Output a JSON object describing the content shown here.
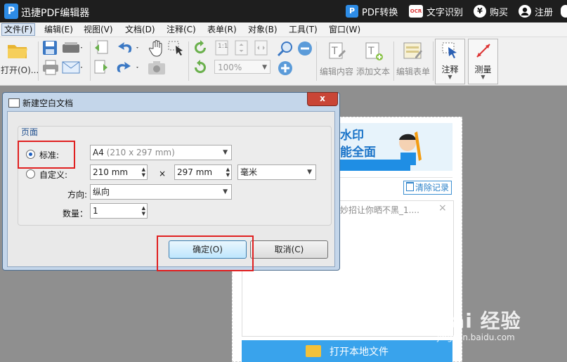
{
  "app": {
    "logo": "P",
    "title": "迅捷PDF编辑器",
    "pdf_convert": "PDF转换",
    "ocr_icon": "OCR",
    "ocr": "文字识别",
    "buy_icon": "¥",
    "buy": "购买",
    "register": "注册"
  },
  "menu": [
    "文件(F)",
    "编辑(E)",
    "视图(V)",
    "文档(D)",
    "注释(C)",
    "表单(R)",
    "对象(B)",
    "工具(T)",
    "窗口(W)"
  ],
  "toolbar": {
    "open": "打开(O)...",
    "zoom": "100%",
    "edit_content": "编辑内容",
    "add_text": "添加文本",
    "edit_form": "编辑表单",
    "annotate": "注释",
    "measure": "测量",
    "page_num": "1:1"
  },
  "panel": {
    "banner_line1": "水印",
    "banner_line2": "能全面",
    "clear_history": "清除记录",
    "recent_file": "妙招让你晒不黑_1....",
    "close_glyph": "×",
    "open_local": "打开本地文件"
  },
  "dialog": {
    "title": "新建空白文档",
    "close": "x",
    "group": "页面",
    "standard_label": "标准:",
    "standard_value": "A4",
    "standard_dims": "(210 x 297 mm)",
    "custom_label": "自定义:",
    "width": "210 mm",
    "times": "×",
    "height": "297 mm",
    "unit": "毫米",
    "orientation_label": "方向:",
    "orientation": "纵向",
    "count_label": "数量：",
    "count": "1",
    "ok": "确定(O)",
    "cancel": "取消(C)"
  },
  "watermark": {
    "main": "Bai 经验",
    "url": "jingyan.baidu.com"
  },
  "colors": {
    "accent": "#39a3ec",
    "highlight": "#e02020",
    "titlebar": "#1e1e1e"
  }
}
